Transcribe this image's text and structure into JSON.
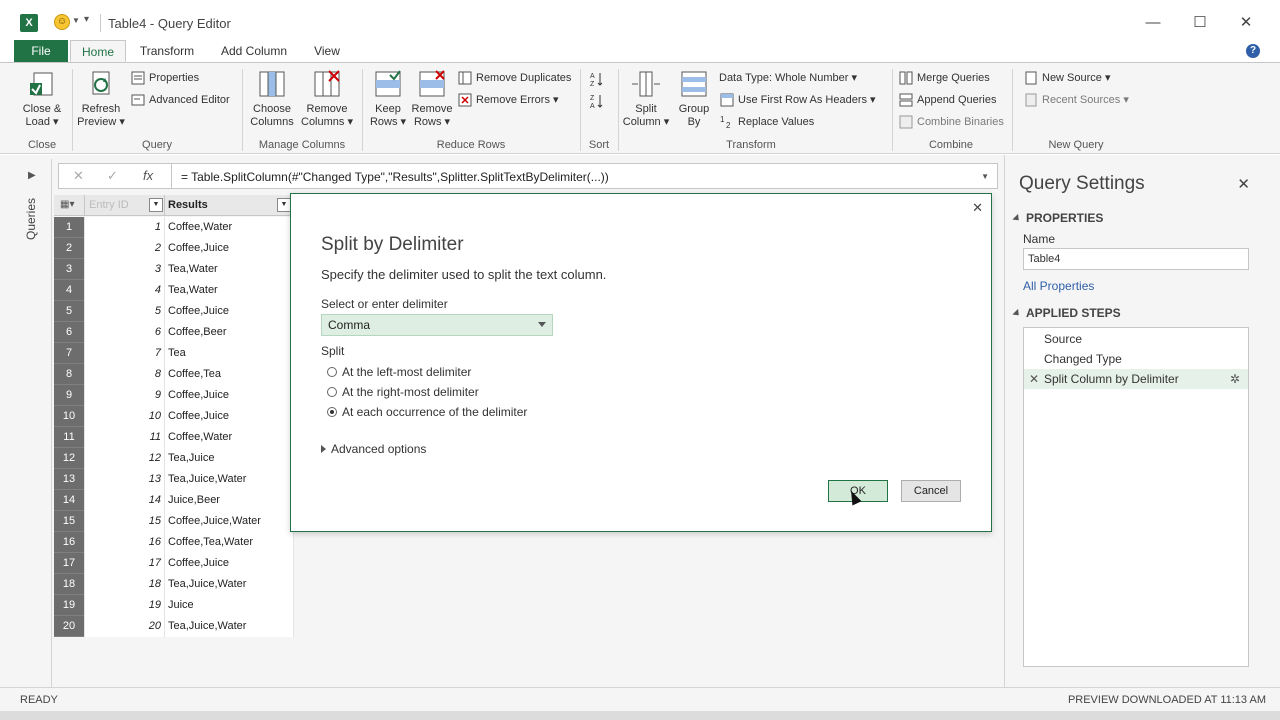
{
  "window": {
    "title": "Table4 - Query Editor",
    "minimize": "—",
    "maximize": "☐",
    "close": "✕"
  },
  "ribbon_tabs": {
    "file": "File",
    "home": "Home",
    "transform": "Transform",
    "add_column": "Add Column",
    "view": "View"
  },
  "ribbon": {
    "close_load": "Close &",
    "close_load2": "Load",
    "refresh": "Refresh",
    "refresh2": "Preview",
    "properties": "Properties",
    "advanced_editor": "Advanced Editor",
    "choose_columns": "Choose",
    "choose_columns2": "Columns",
    "remove_columns": "Remove",
    "remove_columns2": "Columns",
    "keep_rows": "Keep",
    "keep_rows2": "Rows",
    "remove_rows": "Remove",
    "remove_rows2": "Rows",
    "remove_duplicates": "Remove Duplicates",
    "remove_errors": "Remove Errors",
    "split_column": "Split",
    "split_column2": "Column",
    "group_by": "Group",
    "group_by2": "By",
    "data_type": "Data Type: Whole Number",
    "use_first_row": "Use First Row As Headers",
    "replace_values": "Replace Values",
    "merge_queries": "Merge Queries",
    "append_queries": "Append Queries",
    "combine_binaries": "Combine Binaries",
    "new_source": "New Source",
    "recent_sources": "Recent Sources",
    "groups": {
      "close": "Close",
      "query": "Query",
      "manage_columns": "Manage Columns",
      "reduce_rows": "Reduce Rows",
      "sort": "Sort",
      "transform": "Transform",
      "combine": "Combine",
      "new_query": "New Query"
    }
  },
  "queries_pane": {
    "label": "Queries"
  },
  "formula_bar": {
    "cancel": "✕",
    "confirm": "✓",
    "fx": "fx",
    "formula": "= Table.SplitColumn(#\"Changed Type\",\"Results\",Splitter.SplitTextByDelimiter(...))"
  },
  "grid": {
    "col1_header": "Entry ID",
    "col2_header": "Results",
    "rows": [
      {
        "n": "1",
        "id": "1",
        "result": "Coffee,Water"
      },
      {
        "n": "2",
        "id": "2",
        "result": "Coffee,Juice"
      },
      {
        "n": "3",
        "id": "3",
        "result": "Tea,Water"
      },
      {
        "n": "4",
        "id": "4",
        "result": "Tea,Water"
      },
      {
        "n": "5",
        "id": "5",
        "result": "Coffee,Juice"
      },
      {
        "n": "6",
        "id": "6",
        "result": "Coffee,Beer"
      },
      {
        "n": "7",
        "id": "7",
        "result": "Tea"
      },
      {
        "n": "8",
        "id": "8",
        "result": "Coffee,Tea"
      },
      {
        "n": "9",
        "id": "9",
        "result": "Coffee,Juice"
      },
      {
        "n": "10",
        "id": "10",
        "result": "Coffee,Juice"
      },
      {
        "n": "11",
        "id": "11",
        "result": "Coffee,Water"
      },
      {
        "n": "12",
        "id": "12",
        "result": "Tea,Juice"
      },
      {
        "n": "13",
        "id": "13",
        "result": "Tea,Juice,Water"
      },
      {
        "n": "14",
        "id": "14",
        "result": "Juice,Beer"
      },
      {
        "n": "15",
        "id": "15",
        "result": "Coffee,Juice,Water"
      },
      {
        "n": "16",
        "id": "16",
        "result": "Coffee,Tea,Water"
      },
      {
        "n": "17",
        "id": "17",
        "result": "Coffee,Juice"
      },
      {
        "n": "18",
        "id": "18",
        "result": "Tea,Juice,Water"
      },
      {
        "n": "19",
        "id": "19",
        "result": "Juice"
      },
      {
        "n": "20",
        "id": "20",
        "result": "Tea,Juice,Water"
      }
    ]
  },
  "dialog": {
    "title": "Split by Delimiter",
    "description": "Specify the delimiter used to split the text column.",
    "delimiter_label": "Select or enter delimiter",
    "delimiter_value": "Comma",
    "split_label": "Split",
    "options": [
      {
        "label": "At the left-most delimiter",
        "checked": false
      },
      {
        "label": "At the right-most delimiter",
        "checked": false
      },
      {
        "label": "At each occurrence of the delimiter",
        "checked": true
      }
    ],
    "advanced": "Advanced options",
    "ok": "OK",
    "cancel": "Cancel",
    "close": "✕"
  },
  "query_settings": {
    "title": "Query Settings",
    "close": "✕",
    "properties_header": "PROPERTIES",
    "name_label": "Name",
    "name_value": "Table4",
    "all_properties": "All Properties",
    "applied_steps_header": "APPLIED STEPS",
    "steps": [
      {
        "label": "Source",
        "active": false
      },
      {
        "label": "Changed Type",
        "active": false
      },
      {
        "label": "Split Column by Delimiter",
        "active": true
      }
    ]
  },
  "status": {
    "left": "READY",
    "right": "PREVIEW DOWNLOADED AT 11:13 AM"
  },
  "colors": {
    "accent": "#217346",
    "selected_step": "#e6f1e9",
    "link": "#2f5fa8"
  }
}
